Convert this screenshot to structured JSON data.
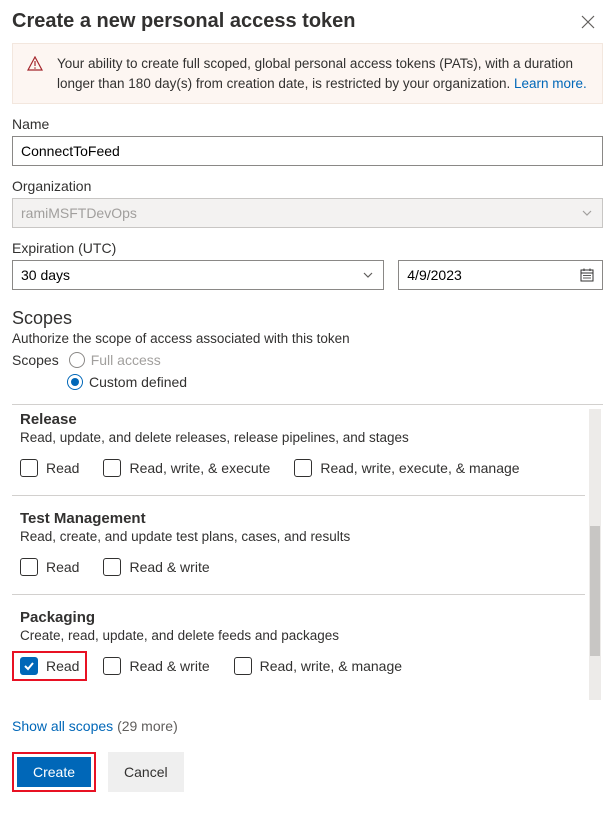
{
  "header": {
    "title": "Create a new personal access token"
  },
  "warning": {
    "text_prefix": "Your ability to create full scoped, global personal access tokens (PATs), with a duration longer than 180 day(s) from creation date, is restricted by your organization. ",
    "learn_more_label": "Learn more."
  },
  "fields": {
    "name_label": "Name",
    "name_value": "ConnectToFeed",
    "org_label": "Organization",
    "org_value": "ramiMSFTDevOps",
    "expiration_label": "Expiration (UTC)",
    "expiration_duration": "30 days",
    "expiration_date": "4/9/2023"
  },
  "scopes_section": {
    "title": "Scopes",
    "subtitle": "Authorize the scope of access associated with this token",
    "label": "Scopes",
    "full_access_label": "Full access",
    "custom_defined_label": "Custom defined"
  },
  "scope_groups": [
    {
      "title": "Release",
      "subtitle": "Read, update, and delete releases, release pipelines, and stages",
      "options": [
        {
          "label": "Read",
          "checked": false
        },
        {
          "label": "Read, write, & execute",
          "checked": false
        },
        {
          "label": "Read, write, execute, & manage",
          "checked": false
        }
      ]
    },
    {
      "title": "Test Management",
      "subtitle": "Read, create, and update test plans, cases, and results",
      "options": [
        {
          "label": "Read",
          "checked": false
        },
        {
          "label": "Read & write",
          "checked": false
        }
      ]
    },
    {
      "title": "Packaging",
      "subtitle": "Create, read, update, and delete feeds and packages",
      "options": [
        {
          "label": "Read",
          "checked": true,
          "highlighted": true
        },
        {
          "label": "Read & write",
          "checked": false
        },
        {
          "label": "Read, write, & manage",
          "checked": false
        }
      ]
    }
  ],
  "show_all": {
    "link_label": "Show all scopes",
    "count_label": "(29 more)"
  },
  "buttons": {
    "create_label": "Create",
    "cancel_label": "Cancel"
  }
}
